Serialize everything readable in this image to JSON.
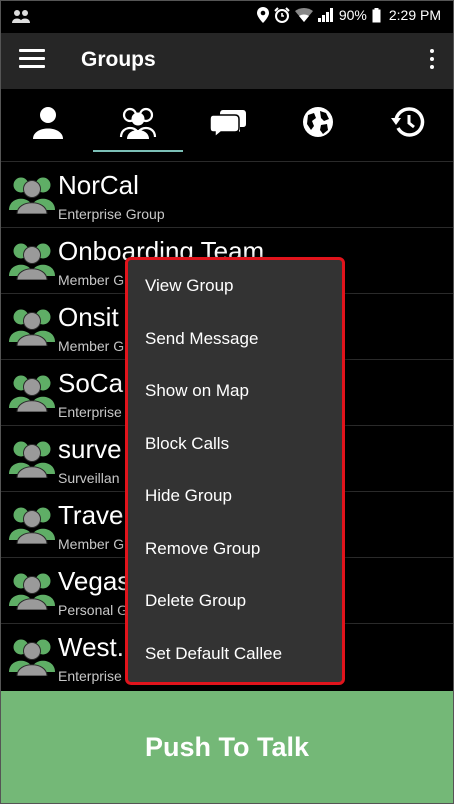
{
  "status_bar": {
    "battery": "90%",
    "time": "2:29 PM"
  },
  "app_bar": {
    "title": "Groups"
  },
  "tabs": [
    {
      "icon": "person-icon"
    },
    {
      "icon": "group-icon",
      "selected": true
    },
    {
      "icon": "chat-bubbles-icon"
    },
    {
      "icon": "globe-icon"
    },
    {
      "icon": "history-icon"
    }
  ],
  "groups": [
    {
      "name": "NorCal",
      "type": "Enterprise Group"
    },
    {
      "name": "Onboarding Team",
      "type": "Member G"
    },
    {
      "name": "Onsit",
      "type": "Member G"
    },
    {
      "name": "SoCa",
      "type": "Enterprise"
    },
    {
      "name": "surve",
      "type": "Surveillan"
    },
    {
      "name": "Trave",
      "type": "Member G"
    },
    {
      "name": "Vegas",
      "type": "Personal G"
    },
    {
      "name": "West.",
      "type": "Enterprise"
    }
  ],
  "context_menu": {
    "items": [
      "View Group",
      "Send Message",
      "Show on Map",
      "Block Calls",
      "Hide Group",
      "Remove Group",
      "Delete Group",
      "Set Default Callee"
    ]
  },
  "ptt": {
    "label": "Push To Talk"
  },
  "colors": {
    "accent_tab": "#7bbfb6",
    "ptt_green": "#74b877",
    "menu_border": "#e0141c",
    "avatar_green": "#5fae66",
    "avatar_gray": "#9a9a9a"
  }
}
